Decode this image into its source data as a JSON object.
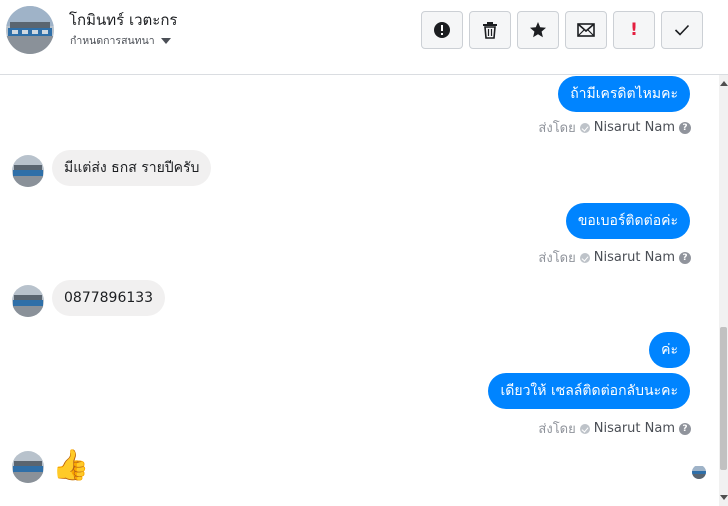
{
  "header": {
    "contact_name": "โกมินทร์ เวตะกร",
    "conversation_setting": "กำหนดการสนทนา"
  },
  "toolbar": {
    "buttons": [
      "mark-spam-icon",
      "delete-icon",
      "star-icon",
      "mark-unread-icon",
      "important-icon",
      "done-icon"
    ],
    "important_glyph": "!"
  },
  "messages": [
    {
      "dir": "out",
      "text": "ถ้ามีเครดิตไหมคะ"
    },
    {
      "dir": "in",
      "text": "มีแต่ส่ง  ธกส รายปีครับ"
    },
    {
      "dir": "out",
      "text": "ขอเบอร์ติดต่อค่ะ"
    },
    {
      "dir": "in",
      "text": "0877896133"
    },
    {
      "dir": "out",
      "text": "ค่ะ"
    },
    {
      "dir": "out",
      "text": "เดียวให้ เซลล์ติดต่อกลับนะคะ"
    },
    {
      "dir": "in",
      "text": "👍"
    }
  ],
  "sent_by": {
    "label": "ส่งโดย",
    "agent": "Nisarut Nam",
    "help_glyph": "?"
  },
  "colors": {
    "outgoing_bubble": "#0084ff",
    "incoming_bubble": "#f1f0f0",
    "important": "#e41e3f"
  }
}
